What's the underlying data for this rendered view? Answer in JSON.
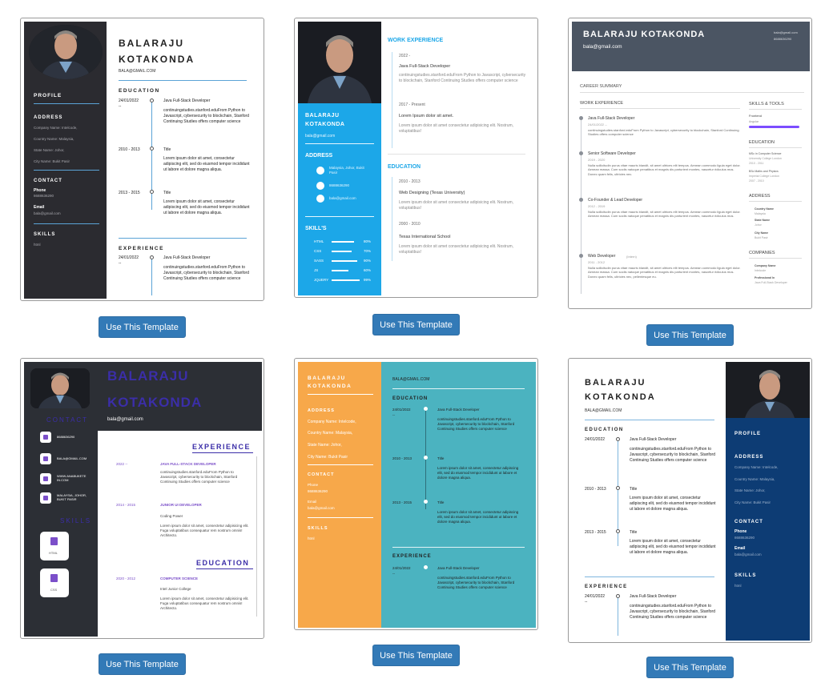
{
  "actions": {
    "use_template": "Use This Template"
  },
  "person": {
    "first": "BALARAJU",
    "last": "KOTAKONDA",
    "full": "BALARAJU KOTAKONDA",
    "email_upper": "BALA@GMAIL.COM",
    "email": "bala@gmail.com",
    "email_alt": "Bala@gmail.com"
  },
  "t1": {
    "profile": "PROFILE",
    "address": "ADDRESS",
    "addr_lines": [
      "Company Name: Intelcode,",
      "Country Name: Malaysia,",
      "State Name: Johor,",
      "City Name: Bukit Pasir"
    ],
    "contact": "CONTACT",
    "phone_label": "Phone",
    "phone": "8688636290",
    "email_label": "Email",
    "skills": "SKILLS",
    "skill": "html",
    "education": "EDUCATION",
    "experience": "EXPERIENCE",
    "entries": [
      {
        "date": "24/01/2022",
        "date2": "--",
        "title": "Java Full-Stack Developer",
        "desc": "continuingstudies.stanford.eduFrom Python to Javascript, cybersecurity to blockchain, Stanford Continuing Studies offers computer science"
      },
      {
        "date": "2010 - 2013",
        "title": "Title",
        "desc": "Lorem ipsum dolor sit amet, consectetur adipiscing elit, sed do eiusmod tempor incididunt ut labore et dolore magna aliqua."
      },
      {
        "date": "2013 - 2015",
        "title": "Title",
        "desc": "Lorem ipsum dolor sit amet, consectetur adipiscing elit, sed do eiusmod tempor incididunt ut labore et dolore magna aliqua."
      }
    ],
    "exp": {
      "date": "24/01/2022",
      "date2": "--",
      "title": "Java Full-Stack Developer",
      "desc": "continuingstudies.stanford.eduFrom Python to Javascript, cybersecurity to blockchain, Stanford Continuing Studies offers computer science"
    }
  },
  "t2": {
    "work": "WORK EXPERIENCE",
    "w1_date": "2022 -",
    "w1_title": "Java Full-Stack Developer",
    "w1_desc": "continuingstudies.stanford.eduFrom Python to Javascript, cybersecurity to blockchain, Stanford Continuing Studies offers computer science",
    "w2_date": "2017 - Present",
    "w2_title": "Lorem Ipsum dolor sit amet.",
    "w2_desc": "Lorem ipsum dolor sit amet consectetur adipisicing elit. Nostrum, voluptatibus!",
    "education": "EDUCATION",
    "e1_date": "2010 - 2013",
    "e1_title": "Web Designing (Texas University)",
    "e1_desc": "Lorem ipsum dolor sit amet consectetur adipisicing elit. Nostrum, voluptatibus!",
    "e2_date": "2000 - 2010",
    "e2_title": "Texas International School",
    "e2_desc": "Lorem ipsum dolor sit amet consectetur adipisicing elit. Nostrum, voluptatibus!",
    "address": "ADDRESS",
    "addr": "Malaysia, Johor, Bukit Pasir",
    "phone": "8688636290",
    "skills": "SKILL'S",
    "skill_list": [
      {
        "name": "HTML",
        "pct": "80%",
        "level": 0.8
      },
      {
        "name": "CSS",
        "pct": "70%",
        "level": 0.7
      },
      {
        "name": "SASS",
        "pct": "90%",
        "level": 0.9
      },
      {
        "name": "JS",
        "pct": "60%",
        "level": 0.6
      },
      {
        "name": "JQUERY",
        "pct": "99%",
        "level": 0.99
      }
    ]
  },
  "t3": {
    "career": "CAREER SUMMARY",
    "work": "WORK EXPERIENCE",
    "jobs": [
      {
        "title": "Java Full-Stack Developer",
        "sub": "24/01/2022 --",
        "desc": "continuingstudies.stanford.eduFrom Python to Javascript, cybersecurity to blockchain, Stanford Continuing Studies offers computer science"
      },
      {
        "title": "Senior Software Developer",
        "sub": "2019 - 2020",
        "desc": "Nulla sollicitudin purus vitae mauris blandit, sit amet ultrices elit tempus. Aenean commodo ligula eget dolor. Aenean massa. Cum sociis natoque penatibus et magnis dis parturient montes, nascetur ridiculus mus. Donec quam felis, ultricies nec."
      },
      {
        "title": "Co-Founder & Lead Developer",
        "sub": "2012 - 2019",
        "desc": "Nulla sollicitudin purus vitae mauris blandit, sit amet ultrices elit tempus. Aenean commodo ligula eget dolor. Aenean massa. Cum sociis natoque penatibus et magnis dis parturient montes, nascetur ridiculus mus."
      },
      {
        "title": "Web Developer",
        "title_tag": "(Intern)",
        "sub": "2011 - 2012",
        "desc": "Nulla sollicitudin purus vitae mauris blandit, sit amet ultrices elit tempus. Aenean commodo ligula eget dolor. Aenean massa. Cum sociis natoque penatibus et magnis dis parturient montes, nascetur ridiculus mus. Donec quam felis, ultricies nec, pellentesque eu."
      }
    ],
    "skills_tools": "SKILLS & TOOLS",
    "frontend": "Frontend",
    "angular": "Angular",
    "education": "EDUCATION",
    "edu1": "MSc in Computer Science",
    "edu1_sub": "University College London",
    "edu1_years": "2010 - 2011",
    "edu2": "BSc Maths and Physics",
    "edu2_sub": "Imperial College London",
    "edu2_years": "2007 - 2010",
    "address": "ADDRESS",
    "addr": [
      {
        "label": "Country Name",
        "value": "Malaysia"
      },
      {
        "label": "State Name",
        "value": "Johor"
      },
      {
        "label": "City Name",
        "value": "Bukit Pasir"
      }
    ],
    "companies": "COMPANIES",
    "company_label": "Company Name",
    "company": "Intelcode",
    "prof_label": "Professional In",
    "prof": "Java Full-Stack Developer",
    "phone": "8688636290"
  },
  "t4": {
    "contact": "CONTACT",
    "contacts": [
      "8688636290",
      "BALA@GMAIL.COM",
      "WWW.ANABUKETE IN.COM",
      "MALAYSIA, JOHOR, BUKIT PASIR"
    ],
    "skills": "SKILLS",
    "skill_items": [
      "HTML",
      "CSS"
    ],
    "experience": "EXPERIENCE",
    "x1_date": "2022 --",
    "x1_title": "JAVA FULL-STACK DEVELOPER",
    "x1_desc": "continuingstudies.stanford.eduFrom Python to Javascript, cybersecurity to blockchain, Stanford Continuing Studies offers computer science",
    "x2_date": "2014 - 2015",
    "x2_title": "JUNIOR UI DEVELOPER",
    "x2_sub": "Coding Power",
    "x2_desc": "Lorem ipsum dolor sit amet, consectetur adipisicing elit. Fuga voluptatibus consequatur rem nostrum omnis! Architecto.",
    "education": "EDUCATION",
    "e1_date": "2020 - 2012",
    "e1_title": "COMPUTER SCIENCE",
    "e1_sub": "Intel Junior College",
    "e1_desc": "Lorem ipsum dolor sit amet, consectetur adipisicing elit. Fuga voluptatibus consequatur rem nostrum omnis! Architecto."
  }
}
